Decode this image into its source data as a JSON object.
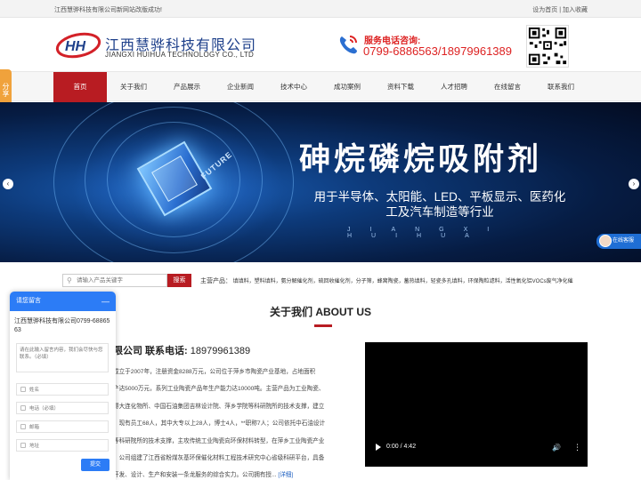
{
  "topbar": {
    "notice": "江西慧骅科技有限公司新网站改版成功!",
    "set_home": "设为首页",
    "separator": "|",
    "add_favorite": "加入收藏"
  },
  "header": {
    "logo_letters": "HH",
    "company_cn": "江西慧骅科技有限公司",
    "company_en": "JIANGXI HUIHUA TECHNOLOGY CO., LTD",
    "phone_label": "服务电话咨询:",
    "phone_number": "0799-6886563/18979961389"
  },
  "nav": {
    "items": [
      "首页",
      "关于我们",
      "产品展示",
      "企业新闻",
      "技术中心",
      "成功案例",
      "资料下载",
      "人才招聘",
      "在线留言",
      "联系我们"
    ]
  },
  "share": {
    "label": "分享"
  },
  "banner": {
    "title": "砷烷磷烷吸附剂",
    "subtitle": "用于半导体、太阳能、LED、平板显示、医药化工及汽车制造等行业",
    "english": "JIANGXI HUIHUA",
    "chip_text": "FUTURE",
    "prev": "‹",
    "next": "›"
  },
  "online_service": {
    "label": "在线客服"
  },
  "search": {
    "placeholder": "请输入产品关键字",
    "button": "搜索",
    "products_label": "主营产品：",
    "products": "填填料，塑料填料，氨分解催化剂，硫回收催化剂，分子筛，蜂窝陶瓷，蓄热填料，轻瓷多孔填料，环保陶粒滤料，活性氧化铝VOCs废气净化催"
  },
  "about": {
    "title": "关于我们 ABOUT US",
    "heading": "限公司 联系电话:",
    "tel": "18979961389",
    "lines": [
      "成立于2007年，注册资金8288万元，公司位于萍乡市陶瓷产业基地，占地面积",
      "产达5000万元，系列工业陶瓷产品年生产能力达10000吨。主营产品为工业陶瓷、",
      "得大连化物所、中国石油集团吉林设计院、萍乡学院等科研院所的技术支撑，建立",
      "。现有员工68人，其中大专以上28人，博士4人，**职称7人；公司依托中石油设计",
      "等科研院所的技术支撑，主攻传统工业陶瓷向环保材料转型，在萍乡工业陶瓷产业",
      "，公司组建了江西省粉煤灰基环保催化材料工程技术研究中心省级科研平台，具备",
      "开发、设计、生产和安装一条龙服务的综合实力。公司拥有授..."
    ],
    "more": "[详细]"
  },
  "video": {
    "time": "0:00 / 4:42",
    "volume_glyph": "🔊",
    "menu_glyph": "⋮"
  },
  "message": {
    "title": "请您留言",
    "minimize": "—",
    "company": "江西慧骅科技有限公司0799-6886563",
    "content_placeholder": "请在此输入留言内容，我们会尽快与您联系。（必填）",
    "name_placeholder": "姓名",
    "phone_placeholder": "电话（必填）",
    "email_placeholder": "邮箱",
    "address_placeholder": "地址",
    "submit": "提交"
  },
  "colors": {
    "brand_red": "#b81c22",
    "brand_blue": "#1d3f8a",
    "widget_blue": "#2c7cf6",
    "share_orange": "#f0a23c"
  }
}
